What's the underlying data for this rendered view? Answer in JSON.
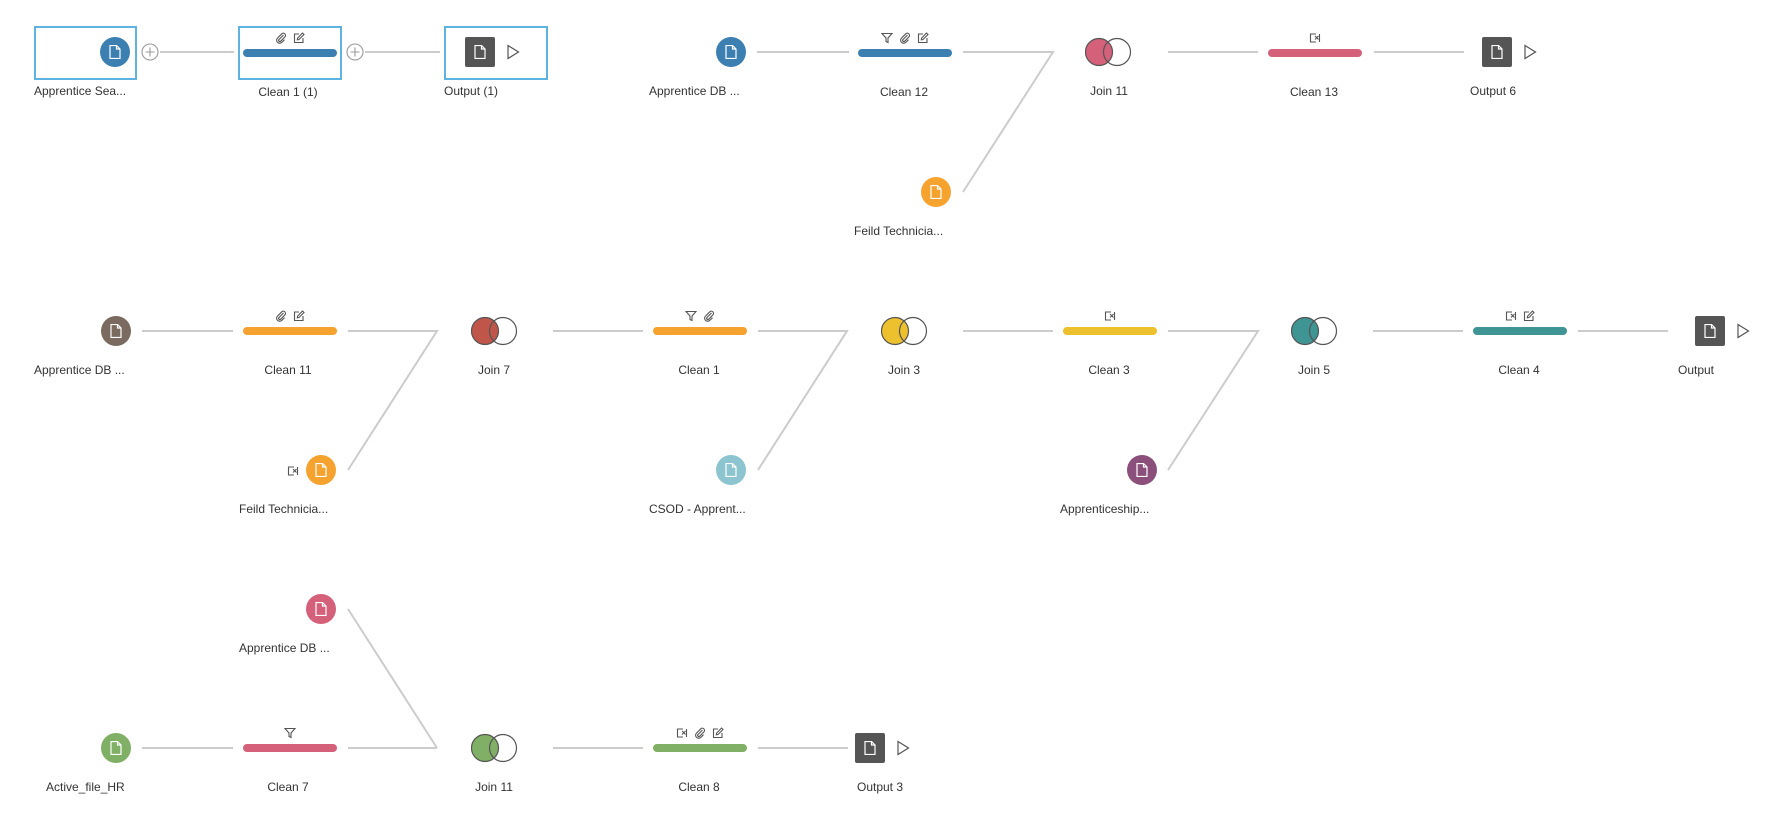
{
  "flow": {
    "nodes": [
      {
        "id": "apprentice-sea",
        "type": "input",
        "label": "Apprentice Sea...",
        "color": "#3c7fb1",
        "selected": true
      },
      {
        "id": "clean-1-1",
        "type": "clean",
        "label": "Clean 1 (1)",
        "color": "#3c7fb1",
        "icons": [
          "paperclip-icon",
          "edit-icon"
        ],
        "selected": true
      },
      {
        "id": "output-1",
        "type": "output",
        "label": "Output (1)",
        "selected": true
      },
      {
        "id": "apprentice-db-top",
        "type": "input",
        "label": "Apprentice DB ...",
        "color": "#3c7fb1"
      },
      {
        "id": "clean-12",
        "type": "clean",
        "label": "Clean 12",
        "color": "#3c7fb1",
        "icons": [
          "filter-icon",
          "paperclip-icon",
          "edit-icon"
        ]
      },
      {
        "id": "feild-tech-top",
        "type": "input",
        "label": "Feild Technicia...",
        "color": "#f5a22f"
      },
      {
        "id": "join-11-top",
        "type": "join",
        "label": "Join 11",
        "color": "#d4607a"
      },
      {
        "id": "clean-13",
        "type": "clean",
        "label": "Clean 13",
        "color": "#d4607a",
        "icons": [
          "rename-icon"
        ]
      },
      {
        "id": "output-6",
        "type": "output",
        "label": "Output 6"
      },
      {
        "id": "apprentice-db-mid",
        "type": "input",
        "label": "Apprentice DB ...",
        "color": "#7a6a60"
      },
      {
        "id": "clean-11",
        "type": "clean",
        "label": "Clean 11",
        "color": "#f5a22f",
        "icons": [
          "paperclip-icon",
          "edit-icon"
        ]
      },
      {
        "id": "feild-tech-mid",
        "type": "input",
        "label": "Feild Technicia...",
        "color": "#f5a22f",
        "extra": "rename-icon"
      },
      {
        "id": "join-7",
        "type": "join",
        "label": "Join 7",
        "color": "#c0554a"
      },
      {
        "id": "clean-1",
        "type": "clean",
        "label": "Clean 1",
        "color": "#f5a22f",
        "icons": [
          "filter-icon",
          "paperclip-icon"
        ]
      },
      {
        "id": "csod",
        "type": "input",
        "label": "CSOD - Apprent...",
        "color": "#8cc4cf"
      },
      {
        "id": "join-3",
        "type": "join",
        "label": "Join 3",
        "color": "#ecc12d"
      },
      {
        "id": "clean-3",
        "type": "clean",
        "label": "Clean 3",
        "color": "#ecc12d",
        "icons": [
          "rename-icon"
        ]
      },
      {
        "id": "apprenticeship",
        "type": "input",
        "label": "Apprenticeship...",
        "color": "#8a4f7b"
      },
      {
        "id": "join-5",
        "type": "join",
        "label": "Join 5",
        "color": "#3f9494"
      },
      {
        "id": "clean-4",
        "type": "clean",
        "label": "Clean 4",
        "color": "#3f9494",
        "icons": [
          "rename-icon",
          "edit-icon"
        ]
      },
      {
        "id": "output",
        "type": "output",
        "label": "Output"
      },
      {
        "id": "apprentice-db-bot",
        "type": "input",
        "label": "Apprentice DB ...",
        "color": "#d4607a"
      },
      {
        "id": "active-file-hr",
        "type": "input",
        "label": "Active_file_HR",
        "color": "#7fb065"
      },
      {
        "id": "clean-7",
        "type": "clean",
        "label": "Clean 7",
        "color": "#d4607a",
        "icons": [
          "filter-icon"
        ]
      },
      {
        "id": "join-11-bot",
        "type": "join",
        "label": "Join 11",
        "color": "#7fb065"
      },
      {
        "id": "clean-8",
        "type": "clean",
        "label": "Clean 8",
        "color": "#7fb065",
        "icons": [
          "rename-icon",
          "paperclip-icon",
          "edit-icon"
        ]
      },
      {
        "id": "output-3",
        "type": "output",
        "label": "Output 3"
      }
    ],
    "links": [
      [
        "apprentice-sea",
        "clean-1-1"
      ],
      [
        "clean-1-1",
        "output-1"
      ],
      [
        "apprentice-db-top",
        "clean-12"
      ],
      [
        "clean-12",
        "join-11-top"
      ],
      [
        "feild-tech-top",
        "join-11-top"
      ],
      [
        "join-11-top",
        "clean-13"
      ],
      [
        "clean-13",
        "output-6"
      ],
      [
        "apprentice-db-mid",
        "clean-11"
      ],
      [
        "clean-11",
        "join-7"
      ],
      [
        "feild-tech-mid",
        "join-7"
      ],
      [
        "join-7",
        "clean-1"
      ],
      [
        "clean-1",
        "join-3"
      ],
      [
        "csod",
        "join-3"
      ],
      [
        "join-3",
        "clean-3"
      ],
      [
        "clean-3",
        "join-5"
      ],
      [
        "apprenticeship",
        "join-5"
      ],
      [
        "join-5",
        "clean-4"
      ],
      [
        "clean-4",
        "output"
      ],
      [
        "apprentice-db-bot",
        "join-11-bot"
      ],
      [
        "active-file-hr",
        "clean-7"
      ],
      [
        "clean-7",
        "join-11-bot"
      ],
      [
        "join-11-bot",
        "clean-8"
      ],
      [
        "clean-8",
        "output-3"
      ]
    ]
  }
}
